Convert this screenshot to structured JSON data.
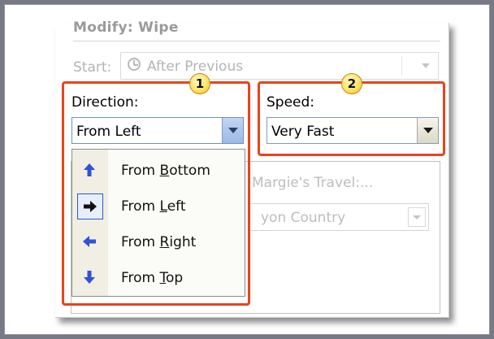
{
  "title": "Modify: Wipe",
  "start": {
    "label": "Start:",
    "value": "After Previous"
  },
  "direction": {
    "label": "Direction:",
    "value": "From Left",
    "badge": "1"
  },
  "speed": {
    "label": "Speed:",
    "value": "Very Fast",
    "badge": "2"
  },
  "background": {
    "list_item": "Margie's Travel:...",
    "combo_value": "yon Country"
  },
  "direction_menu": [
    {
      "pre": "From ",
      "key": "B",
      "post": "ottom",
      "icon": "arrow-up-icon"
    },
    {
      "pre": "From ",
      "key": "L",
      "post": "eft",
      "icon": "arrow-right-icon"
    },
    {
      "pre": "From ",
      "key": "R",
      "post": "ight",
      "icon": "arrow-left-icon"
    },
    {
      "pre": "From ",
      "key": "T",
      "post": "op",
      "icon": "arrow-down-icon"
    }
  ],
  "colors": {
    "callout_border": "#e8441c",
    "badge_fill": "#ffe36a",
    "arrow_blue": "#2f52d6",
    "selected_border": "#2f5bc4"
  }
}
